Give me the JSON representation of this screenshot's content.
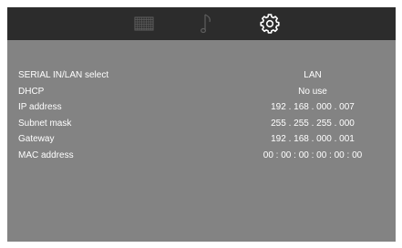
{
  "tabs": {
    "display_icon": "display-grid-icon",
    "audio_icon": "music-note-icon",
    "settings_icon": "gear-icon",
    "active": "settings"
  },
  "settings": {
    "rows": [
      {
        "label": "SERIAL IN/LAN select",
        "value": "LAN"
      },
      {
        "label": "DHCP",
        "value": "No use"
      },
      {
        "label": "IP address",
        "value": "192 . 168 . 000 . 007"
      },
      {
        "label": "Subnet mask",
        "value": "255 . 255 . 255 . 000"
      },
      {
        "label": "Gateway",
        "value": "192 . 168 . 000 . 001"
      },
      {
        "label": "MAC address",
        "value": "00 : 00 : 00 : 00 : 00 : 00"
      }
    ]
  },
  "colors": {
    "background": "#838383",
    "topbar": "#2c2c2c",
    "text": "#ffffff",
    "inactive_icon": "#5e5e5e",
    "active_icon": "#ffffff"
  }
}
